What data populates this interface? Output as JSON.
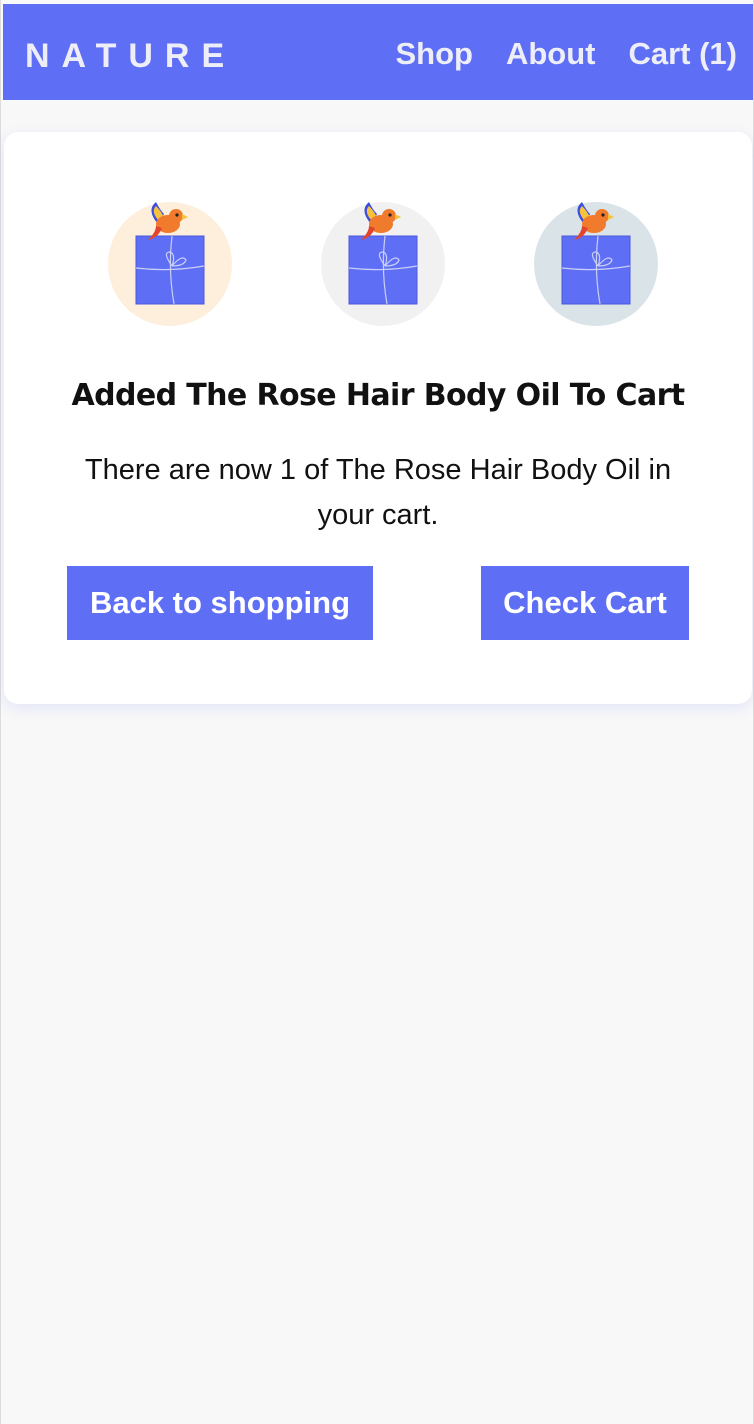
{
  "header": {
    "brand": "NATURE",
    "nav": [
      "Shop",
      "About",
      "Cart (1)"
    ]
  },
  "product_images": [
    {
      "name": "gift-box-with-parrot",
      "background": "#fdefdc"
    },
    {
      "name": "gift-box-with-parrot",
      "background": "#f1f1f1"
    },
    {
      "name": "gift-box-with-parrot",
      "background": "#dae4e8"
    }
  ],
  "confirmation": {
    "title": "Added The Rose Hair Body Oil To Cart",
    "message": "There are now 1 of The Rose Hair Body Oil in your cart."
  },
  "actions": {
    "back_label": "Back to shopping",
    "cart_label": "Check Cart"
  },
  "colors": {
    "accent": "#5f6ff5",
    "page_background": "#f8f8f8",
    "card_background": "#ffffff"
  }
}
